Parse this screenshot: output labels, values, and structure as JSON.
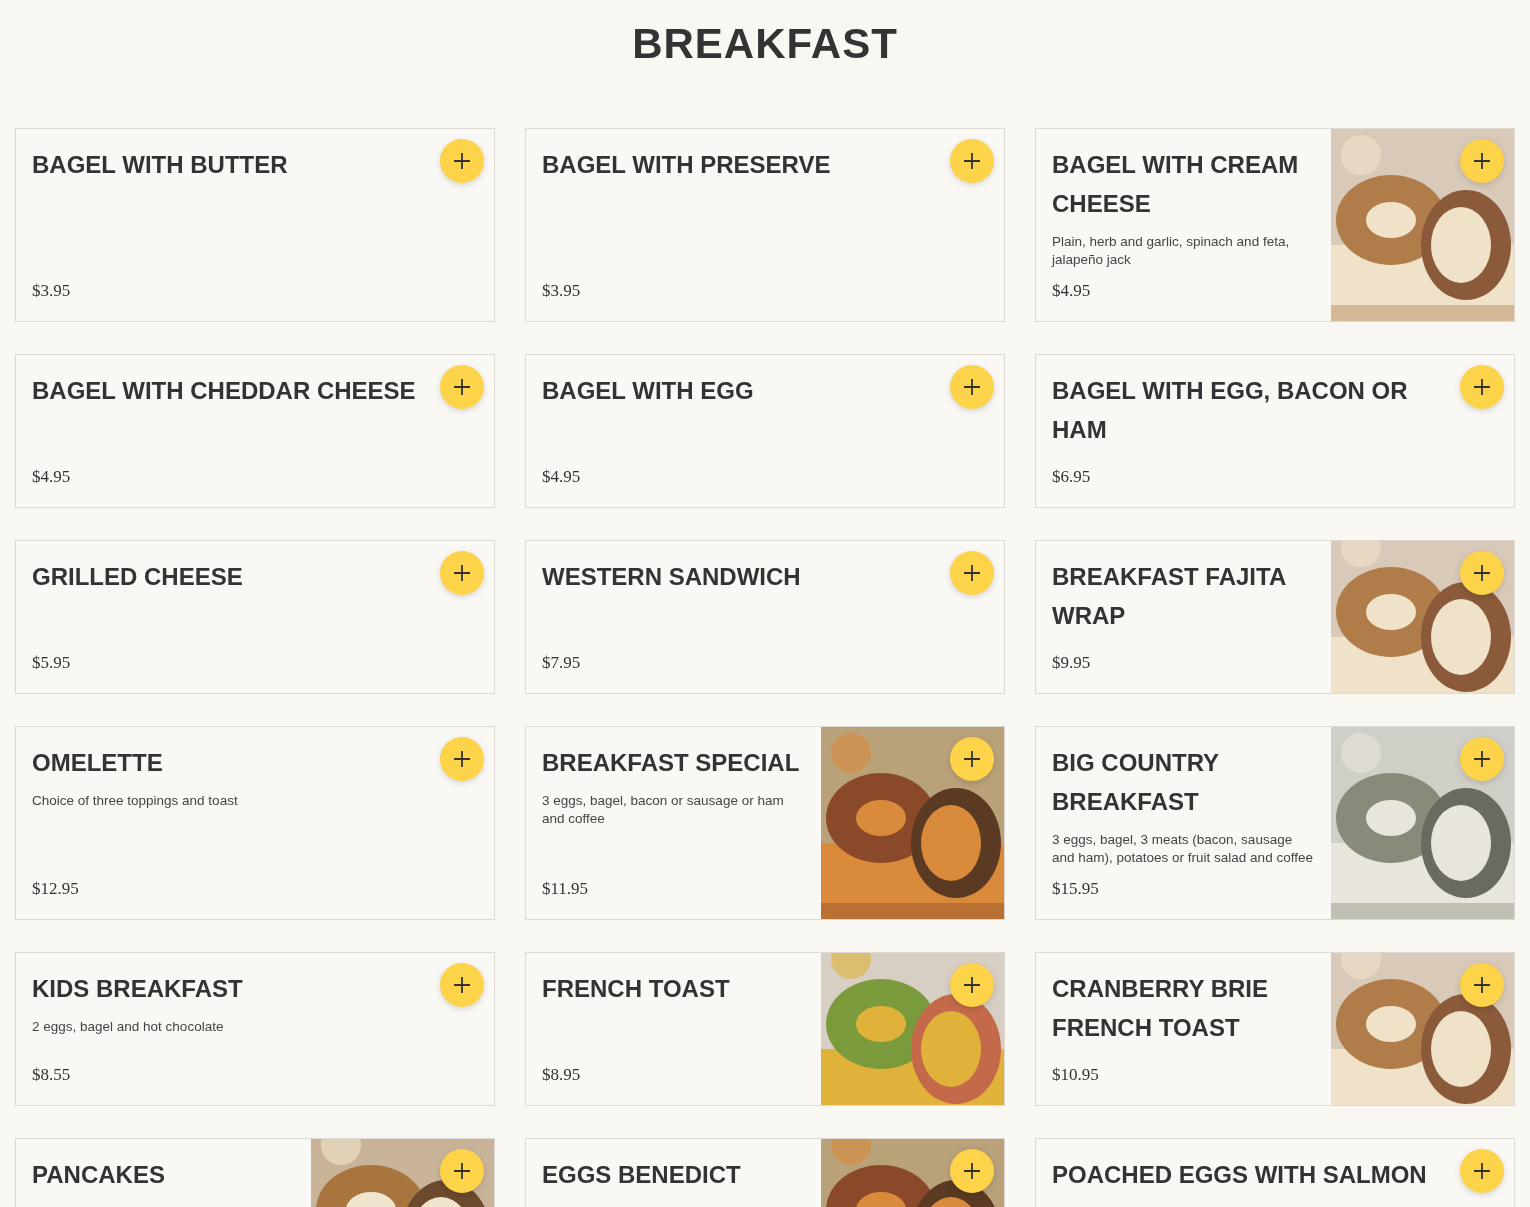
{
  "title": "BREAKFAST",
  "items": [
    {
      "name": "BAGEL WITH BUTTER",
      "price": "$3.95"
    },
    {
      "name": "BAGEL WITH PRESERVE",
      "price": "$3.95"
    },
    {
      "name": "BAGEL WITH CREAM CHEESE",
      "description": "Plain, herb and garlic, spinach and feta, jalapeño jack",
      "price": "$4.95"
    },
    {
      "name": "BAGEL WITH CHEDDAR CHEESE",
      "price": "$4.95"
    },
    {
      "name": "BAGEL WITH EGG",
      "price": "$4.95"
    },
    {
      "name": "BAGEL WITH EGG, BACON OR HAM",
      "price": "$6.95"
    },
    {
      "name": "GRILLED CHEESE",
      "price": "$5.95"
    },
    {
      "name": "WESTERN SANDWICH",
      "price": "$7.95"
    },
    {
      "name": "BREAKFAST FAJITA WRAP",
      "price": "$9.95"
    },
    {
      "name": "OMELETTE",
      "description": "Choice of three toppings and toast",
      "price": "$12.95"
    },
    {
      "name": "BREAKFAST SPECIAL",
      "description": "3 eggs, bagel, bacon or sausage or ham and coffee",
      "price": "$11.95"
    },
    {
      "name": "BIG COUNTRY BREAKFAST",
      "description": "3 eggs, bagel, 3 meats (bacon, sausage and ham), potatoes or fruit salad and coffee",
      "price": "$15.95"
    },
    {
      "name": "KIDS BREAKFAST",
      "description": "2 eggs, bagel and hot chocolate",
      "price": "$8.55"
    },
    {
      "name": "FRENCH TOAST",
      "price": "$8.95"
    },
    {
      "name": "CRANBERRY BRIE FRENCH TOAST",
      "price": "$10.95"
    },
    {
      "name": "PANCAKES"
    },
    {
      "name": "EGGS BENEDICT"
    },
    {
      "name": "POACHED EGGS WITH SALMON"
    }
  ]
}
